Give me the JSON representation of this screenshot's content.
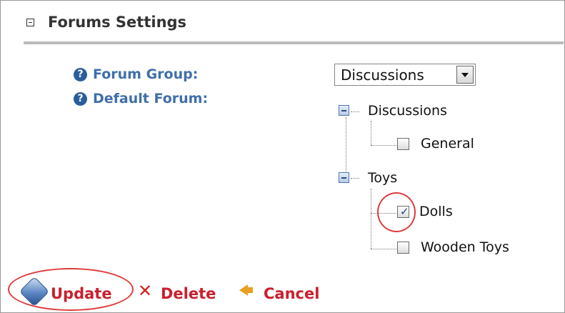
{
  "section": {
    "title": "Forums Settings"
  },
  "fields": {
    "forum_group_label": "Forum Group:",
    "default_forum_label": "Default Forum:",
    "help_glyph": "?"
  },
  "forum_group_select": {
    "selected": "Discussions"
  },
  "tree": {
    "groups": [
      {
        "label": "Discussions",
        "children": [
          {
            "label": "General",
            "checked": false
          }
        ]
      },
      {
        "label": "Toys",
        "children": [
          {
            "label": "Dolls",
            "checked": true
          },
          {
            "label": "Wooden Toys",
            "checked": false
          }
        ]
      }
    ]
  },
  "actions": {
    "update": "Update",
    "delete": "Delete",
    "cancel": "Cancel"
  },
  "icons": {
    "collapse": "collapse-icon",
    "help": "help-icon",
    "tree_expander": "tree-collapse-icon",
    "update": "update-icon",
    "delete": "delete-x-icon",
    "cancel": "back-arrow-icon"
  },
  "colors": {
    "label_blue": "#3f6fa8",
    "action_red": "#c8202e",
    "annotation_red": "#e03c3c"
  }
}
